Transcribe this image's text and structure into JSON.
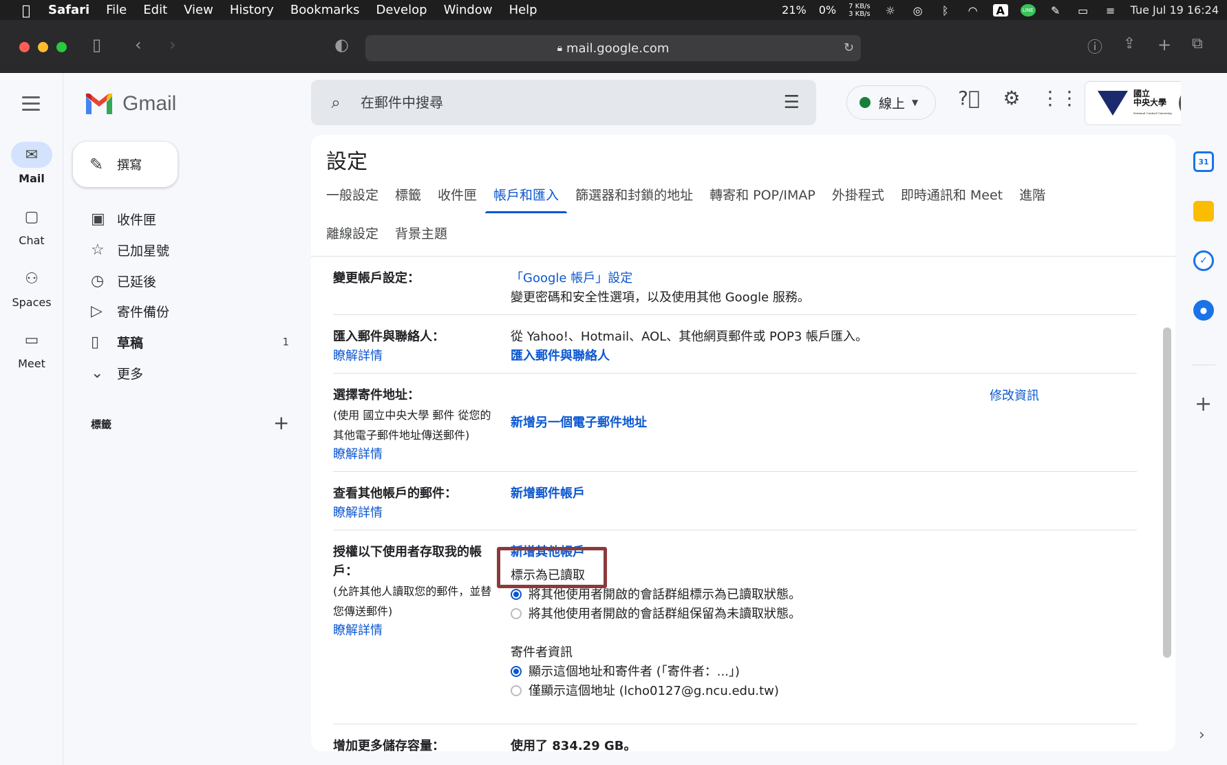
{
  "menubar": {
    "app": "Safari",
    "items": [
      "File",
      "Edit",
      "View",
      "History",
      "Bookmarks",
      "Develop",
      "Window",
      "Help"
    ],
    "battery_cpu": "21%",
    "cpu2": "0%",
    "net_up": "7 KB/s",
    "net_down": "3 KB/s",
    "input_indicator": "A",
    "line_badge": "LINE",
    "clock": "Tue Jul 19  16:24"
  },
  "browser": {
    "url": "mail.google.com"
  },
  "rail": {
    "items": [
      {
        "label": "Mail",
        "icon": "mail-icon"
      },
      {
        "label": "Chat",
        "icon": "chat-icon"
      },
      {
        "label": "Spaces",
        "icon": "spaces-icon"
      },
      {
        "label": "Meet",
        "icon": "meet-icon"
      }
    ]
  },
  "brand": {
    "name": "Gmail"
  },
  "compose": {
    "label": "撰寫"
  },
  "nav": {
    "items": [
      {
        "label": "收件匣",
        "icon": "inbox-icon",
        "count": ""
      },
      {
        "label": "已加星號",
        "icon": "star-icon",
        "count": ""
      },
      {
        "label": "已延後",
        "icon": "clock-icon",
        "count": ""
      },
      {
        "label": "寄件備份",
        "icon": "send-icon",
        "count": ""
      },
      {
        "label": "草稿",
        "icon": "draft-icon",
        "count": "1"
      },
      {
        "label": "更多",
        "icon": "chevron-down-icon",
        "count": ""
      }
    ],
    "labels_heading": "標籤"
  },
  "search": {
    "placeholder": "在郵件中搜尋"
  },
  "status": {
    "label": "線上",
    "color": "#188038"
  },
  "org": {
    "name_line1": "國立",
    "name_line2": "中央大學",
    "name_line3": "National Central University"
  },
  "settings": {
    "title": "設定",
    "tabs_row1": [
      "一般設定",
      "標籤",
      "收件匣",
      "帳戶和匯入",
      "篩選器和封鎖的地址",
      "轉寄和 POP/IMAP",
      "外掛程式",
      "即時通訊和 Meet",
      "進階"
    ],
    "tabs_row2": [
      "離線設定",
      "背景主題"
    ],
    "active_tab": "帳戶和匯入",
    "rows": {
      "change_account": {
        "label": "變更帳戶設定：",
        "link": "「Google 帳戶」設定",
        "desc": "變更密碼和安全性選項，以及使用其他 Google 服務。"
      },
      "import": {
        "label": "匯入郵件與聯絡人：",
        "learn": "瞭解詳情",
        "desc": "從 Yahoo!、Hotmail、AOL、其他網頁郵件或 POP3 帳戶匯入。",
        "link": "匯入郵件與聯絡人"
      },
      "send_as": {
        "label": "選擇寄件地址：",
        "sub1": "(使用 國立中央大學 郵件 從您的",
        "sub2": "其他電子郵件地址傳送郵件)",
        "learn": "瞭解詳情",
        "edit": "修改資訊",
        "link": "新增另一個電子郵件地址"
      },
      "check_mail": {
        "label": "查看其他帳戶的郵件：",
        "learn": "瞭解詳情",
        "link": "新增郵件帳戶"
      },
      "delegate": {
        "label_line1": "授權以下使用者存取我的帳",
        "label_line2": "戶：",
        "sub1": "(允許其他人讀取您的郵件，並替",
        "sub2": "您傳送郵件)",
        "learn": "瞭解詳情",
        "link": "新增其他帳戶",
        "mark_read_heading": "標示為已讀取",
        "mark_read_opt1": "將其他使用者開啟的會話群組標示為已讀取狀態。",
        "mark_read_opt2": "將其他使用者開啟的會話群組保留為未讀取狀態。",
        "sender_heading": "寄件者資訊",
        "sender_opt1": "顯示這個地址和寄件者 (「寄件者：...」)",
        "sender_opt2": "僅顯示這個地址 (lcho0127@g.ncu.edu.tw)"
      },
      "storage": {
        "label": "增加更多儲存容量：",
        "value": "使用了 834.29 GB。"
      }
    }
  },
  "sidepanel": {
    "items": [
      {
        "icon": "calendar-icon",
        "text": "31",
        "color": "#1a73e8"
      },
      {
        "icon": "keep-icon",
        "text": "",
        "color": "#fbbc04"
      },
      {
        "icon": "tasks-icon",
        "text": "✓",
        "color": "#1a73e8"
      },
      {
        "icon": "contacts-icon",
        "text": "●",
        "color": "#1a73e8"
      }
    ]
  }
}
